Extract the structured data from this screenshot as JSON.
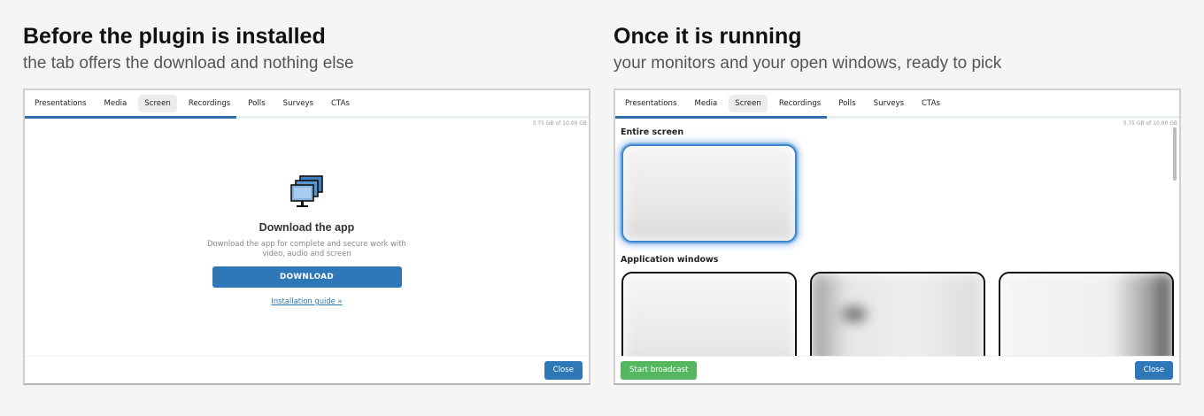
{
  "left_panel": {
    "heading": "Before the plugin is installed",
    "subheading": "the tab offers the download and nothing else",
    "tabs": [
      "Presentations",
      "Media",
      "Screen",
      "Recordings",
      "Polls",
      "Surveys",
      "CTAs"
    ],
    "active_tab": "Screen",
    "storage": "3.75 GB of 10.00 GB",
    "download_title": "Download the app",
    "download_desc": "Download the app for complete and secure work with video, audio and screen",
    "download_button": "DOWNLOAD",
    "install_link": "Installation guide »",
    "close_button": "Close"
  },
  "right_panel": {
    "heading": "Once it is running",
    "subheading": "your monitors and your open windows, ready to pick",
    "tabs": [
      "Presentations",
      "Media",
      "Screen",
      "Recordings",
      "Polls",
      "Surveys",
      "CTAs"
    ],
    "active_tab": "Screen",
    "storage": "3.75 GB of 10.00 GB",
    "entire_screen_label": "Entire screen",
    "app_windows_label": "Application windows",
    "start_broadcast_button": "Start broadcast",
    "close_button": "Close"
  },
  "colors": {
    "accent": "#2f78b8",
    "broadcast": "#55b75f",
    "selected_glow": "#4a90d9"
  }
}
